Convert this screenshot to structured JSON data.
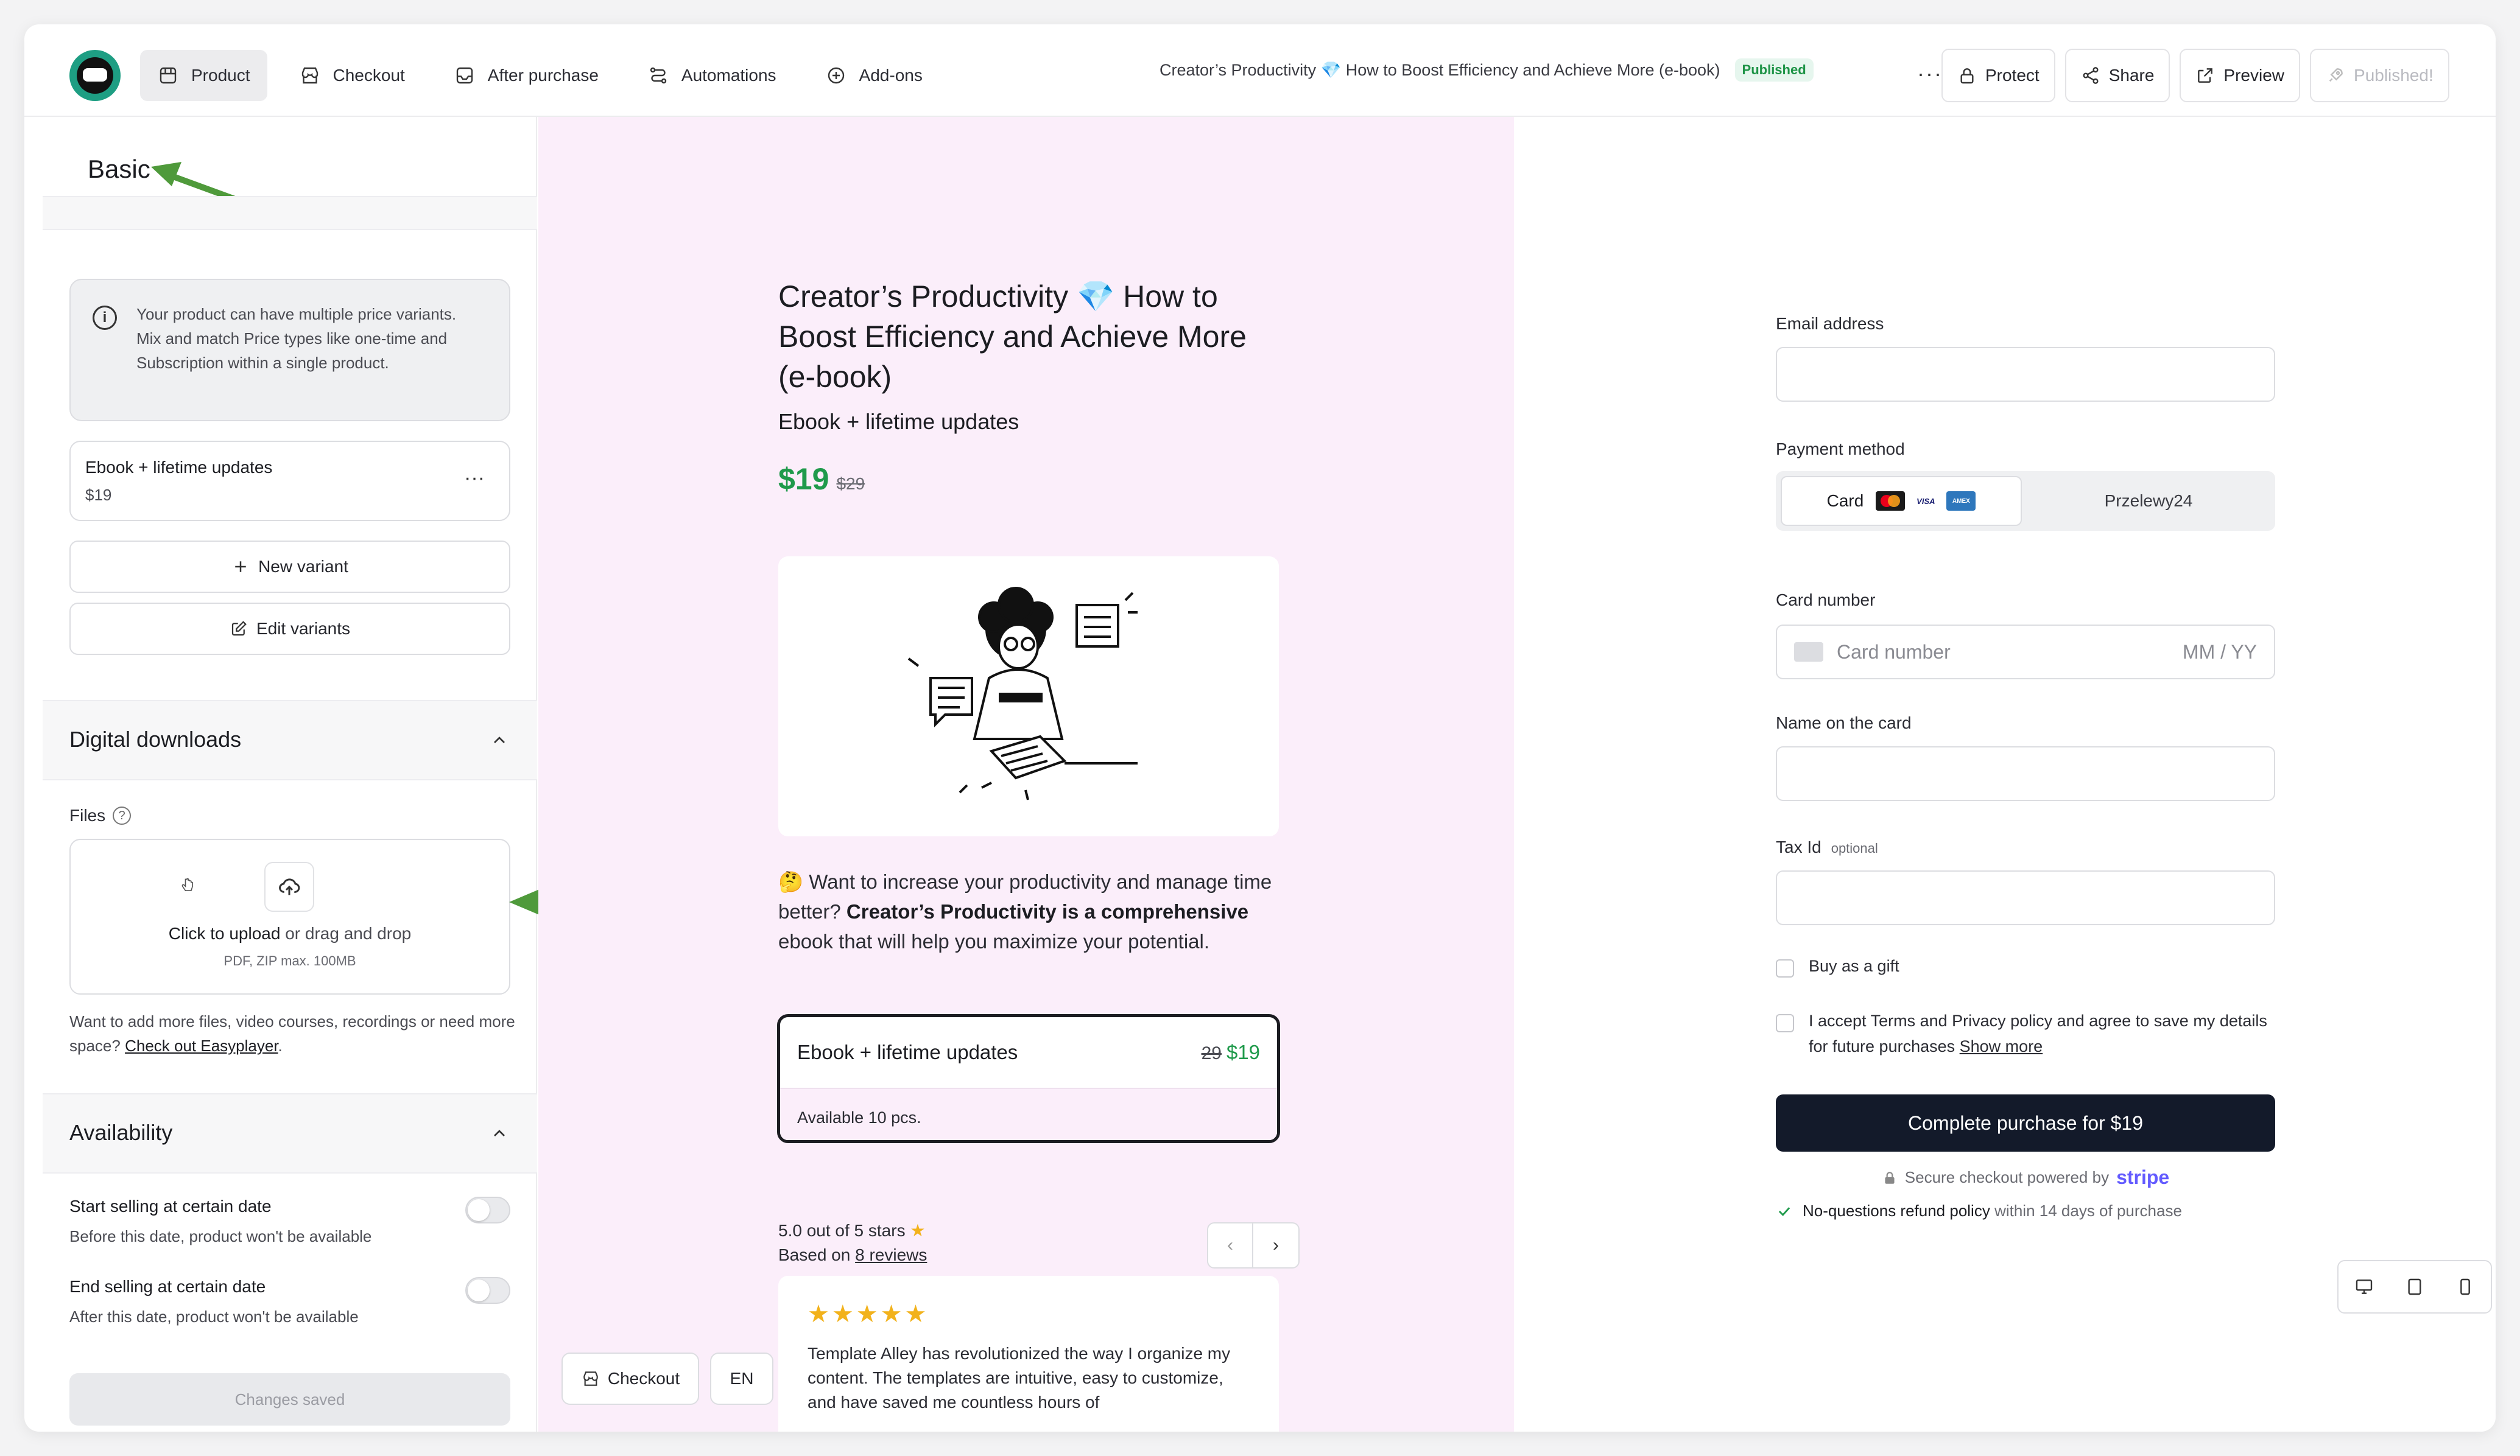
{
  "nav": {
    "items": [
      {
        "label": "Product",
        "icon": "box-icon"
      },
      {
        "label": "Checkout",
        "icon": "store-icon"
      },
      {
        "label": "After purchase",
        "icon": "inbox-icon"
      },
      {
        "label": "Automations",
        "icon": "workflow-icon"
      },
      {
        "label": "Add-ons",
        "icon": "plus-circle-icon"
      }
    ],
    "active": "Product"
  },
  "header": {
    "product_title": "Creator’s Productivity 💎 How to Boost Efficiency and Achieve More (e-book)",
    "status_badge": "Published",
    "more": "···",
    "buttons": {
      "protect": "Protect",
      "share": "Share",
      "preview": "Preview",
      "published": "Published!"
    }
  },
  "left": {
    "section_title": "Basic",
    "info_text": "Your product can have multiple price variants. Mix and match Price types like one-time and Subscription within a single product.",
    "variant": {
      "name": "Ebook + lifetime updates",
      "price": "$19",
      "menu": "···"
    },
    "new_variant": "New variant",
    "edit_variants": "Edit variants",
    "digital_downloads": "Digital downloads",
    "files_label": "Files",
    "upload_strong": "Click to upload",
    "upload_rest": " or drag and drop",
    "upload_hint": "PDF, ZIP max. 100MB",
    "more_files_text": "Want to add more files, video courses, recordings or need more space? ",
    "more_files_link": "Check out Easyplayer",
    "more_files_end": ".",
    "availability": "Availability",
    "start_selling_title": "Start selling at certain date",
    "start_selling_desc": "Before this date, product won't be available",
    "end_selling_title": "End selling at certain date",
    "end_selling_desc": "After this date, product won't be available",
    "changes_saved": "Changes saved"
  },
  "preview": {
    "title": "Creator’s Productivity 💎 How to Boost Efficiency and Achieve More (e-book)",
    "subtitle": "Ebook + lifetime updates",
    "price_now": "$19",
    "price_old": "$29",
    "desc_emoji": "🤔",
    "desc_1": " Want to increase your productivity and manage time better? ",
    "desc_bold": "Creator’s Productivity is a comprehensive",
    "desc_2": " ebook that will help you maximize your potential.",
    "variant_card": {
      "name": "Ebook + lifetime updates",
      "old": "29",
      "now": "$19",
      "availability": "Available 10 pcs."
    },
    "rating_text": "5.0 out of 5 stars",
    "based_on": "Based on ",
    "reviews_link": "8 reviews",
    "review_stars": "★★★★★",
    "review_text": "Template Alley has revolutionized the way I organize my content. The templates are intuitive, easy to customize, and have saved me countless hours of",
    "checkout_btn": "Checkout",
    "lang_btn": "EN"
  },
  "checkout": {
    "email_label": "Email address",
    "payment_label": "Payment method",
    "tab_card": "Card",
    "tab_p24": "Przelewy24",
    "card_number_label": "Card number",
    "card_number_placeholder": "Card number",
    "expiry_placeholder": "MM / YY",
    "name_label": "Name on the card",
    "tax_label": "Tax Id",
    "tax_optional": "optional",
    "gift": "Buy as a gift",
    "terms_text": "I accept Terms and Privacy policy and agree to save my details for future purchases ",
    "show_more": "Show more",
    "complete_btn": "Complete purchase for $19",
    "secure_text": "Secure checkout powered by",
    "stripe": "stripe",
    "refund_bold": "No-questions refund policy",
    "refund_rest": " within 14 days of purchase"
  },
  "colors": {
    "accent_green": "#1f9a4b",
    "preview_bg": "#fbeefa",
    "primary_dark": "#131a2a",
    "stripe": "#635bff"
  }
}
